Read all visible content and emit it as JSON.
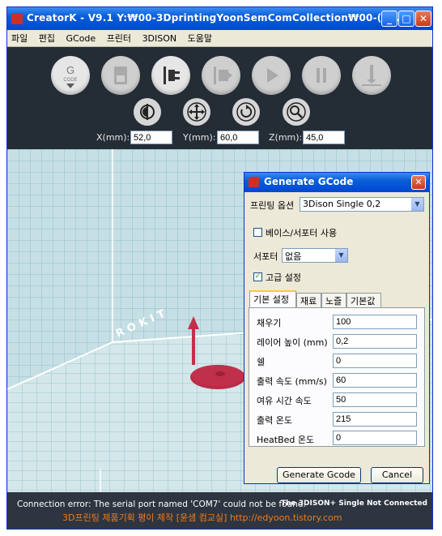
{
  "window": {
    "title": "CreatorK - V9.1  Y:₩00-3DprintingYoonSemComCollection₩00-(00...",
    "buttons": {
      "minimize": "_",
      "maximize": "□",
      "close": "✕"
    }
  },
  "menu": {
    "items": [
      "파일",
      "편집",
      "GCode",
      "프린터",
      "3DISON",
      "도움말"
    ]
  },
  "toolbar": {
    "main_buttons": [
      {
        "icon": "gcode-icon",
        "label": "G\nCODE",
        "active": true
      },
      {
        "icon": "sd-card-icon",
        "active": false
      },
      {
        "icon": "connect-plug-icon",
        "active": true
      },
      {
        "icon": "transfer-icon",
        "active": false
      },
      {
        "icon": "play-icon",
        "active": false
      },
      {
        "icon": "pause-icon",
        "active": false
      },
      {
        "icon": "nozzle-icon",
        "active": false
      }
    ],
    "view_buttons": [
      "mirror-icon",
      "move-icon",
      "rotate-icon",
      "zoom-icon"
    ],
    "coords": {
      "x_label": "X(mm):",
      "x_value": "52,0",
      "y_label": "Y(mm):",
      "y_value": "60,0",
      "z_label": "Z(mm):",
      "z_value": "45,0"
    }
  },
  "viewport": {
    "bed_label": "ROKIT"
  },
  "dialog": {
    "title": "Generate GCode",
    "close": "✕",
    "print_option_label": "프린팅 옵션",
    "print_option_value": "3Dison Single 0,2",
    "base_support_label": "베이스/서포터 사용",
    "base_support_checked": false,
    "support_label": "서포터",
    "support_value": "없음",
    "advanced_label": "고급 설정",
    "advanced_checked": true,
    "tabs": [
      "기본 설정",
      "재료",
      "노즐",
      "기본값"
    ],
    "active_tab": "기본 설정",
    "fields": [
      {
        "label": "채우기",
        "value": "100"
      },
      {
        "label": "레이어 높이 (mm)",
        "value": "0,2"
      },
      {
        "label": "쉘",
        "value": "0"
      },
      {
        "label": "출력 속도 (mm/s)",
        "value": "60"
      },
      {
        "label": "여유 시간 속도",
        "value": "50"
      },
      {
        "label": "출력 온도",
        "value": "215"
      },
      {
        "label": "HeatBed 온도",
        "value": "0"
      }
    ],
    "generate_button": "Generate Gcode",
    "cancel_button": "Cancel"
  },
  "status": {
    "error": "Connection error: The serial port named 'COM7' could not be found.",
    "connection": "The 3DISON+ Single Not Connected",
    "watermark": "3D프린팅 제품기획 평이 제작 [윤샘 컴교실]  http://edyoon.tistory.com"
  },
  "colors": {
    "accent": "#0a5ed7",
    "toolbar_bg": "#242c36",
    "viewport_bg": "#c6dfe4",
    "model": "#c0304a",
    "watermark": "#f07b1a"
  }
}
